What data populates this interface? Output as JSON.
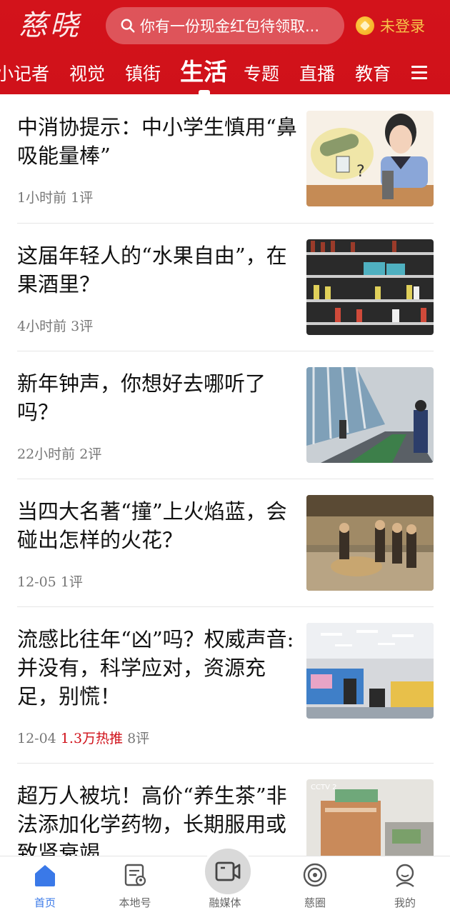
{
  "header": {
    "logo_text": "慈晓",
    "search_placeholder": "你有一份现金红包待领取...",
    "login_label": "未登录"
  },
  "nav_tabs": [
    "小记者",
    "视觉",
    "镇街",
    "生活",
    "专题",
    "直播",
    "教育"
  ],
  "active_tab": "生活",
  "feed": [
    {
      "title": "中消协提示：中小学生慎用“鼻吸能量棒”",
      "time": "1小时前",
      "comments": "1评",
      "hot": ""
    },
    {
      "title": "这届年轻人的“水果自由”，在果酒里？",
      "time": "4小时前",
      "comments": "3评",
      "hot": ""
    },
    {
      "title": "新年钟声，你想好去哪听了吗？",
      "time": "22小时前",
      "comments": "2评",
      "hot": ""
    },
    {
      "title": "当四大名著“撞”上火焰蓝，会碰出怎样的火花？",
      "time": "12-05",
      "comments": "1评",
      "hot": ""
    },
    {
      "title": "流感比往年“凶”吗？权威声音:并没有，科学应对，资源充足，别慌！",
      "time": "12-04",
      "comments": "8评",
      "hot": "1.3万热推"
    },
    {
      "title": "超万人被坑！高价“养生茶”非法添加化学药物，长期服用或致肾衰竭",
      "time": "",
      "comments": "",
      "hot": ""
    }
  ],
  "tabbar": [
    {
      "label": "首页",
      "icon": "home-icon",
      "active": true
    },
    {
      "label": "本地号",
      "icon": "local-account-icon",
      "active": false
    },
    {
      "label": "融媒体",
      "icon": "video-camera-icon",
      "active": false
    },
    {
      "label": "慈圈",
      "icon": "circle-target-icon",
      "active": false
    },
    {
      "label": "我的",
      "icon": "profile-icon",
      "active": false
    }
  ],
  "colors": {
    "brand_red": "#d0111a",
    "accent_blue": "#3a79e8",
    "login_gold": "#f7c44a"
  }
}
